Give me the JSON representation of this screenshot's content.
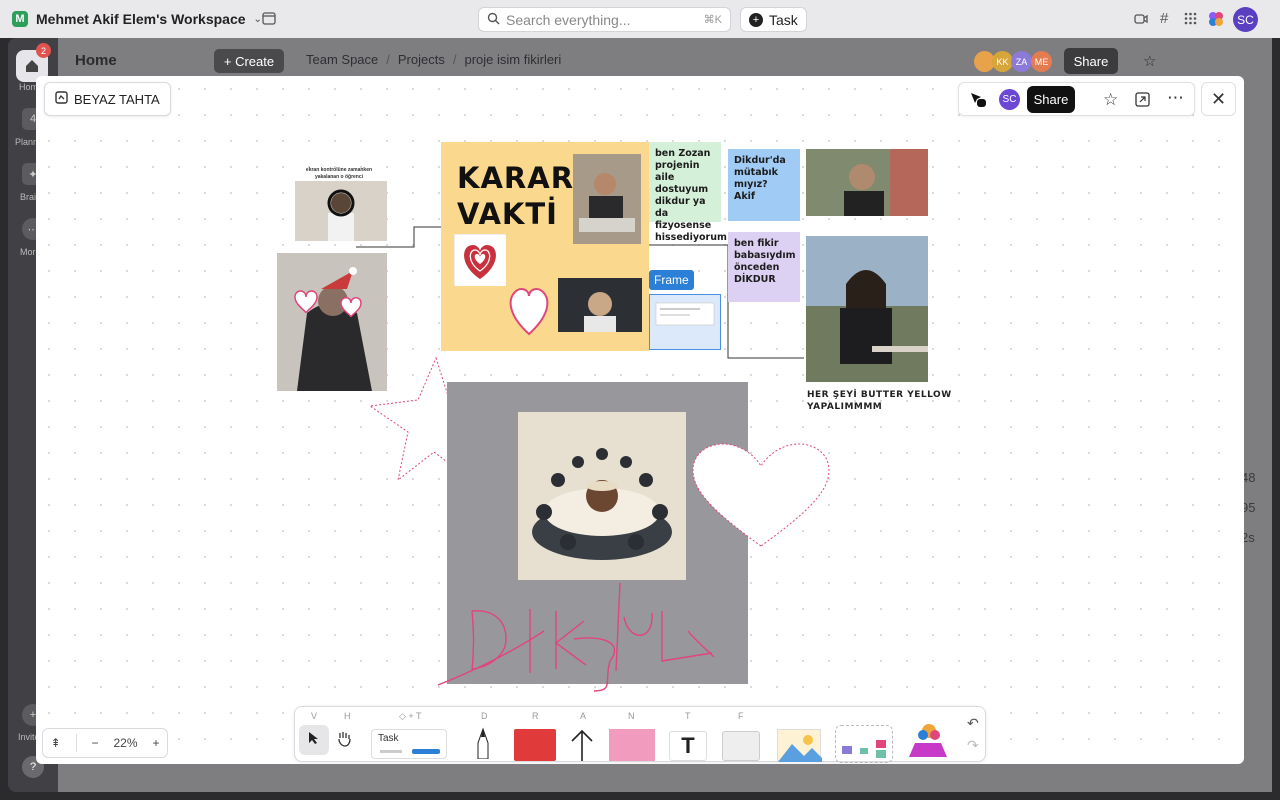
{
  "topbar": {
    "workspace_initial": "M",
    "workspace_name": "Mehmet Akif Elem's Workspace",
    "search_placeholder": "Search everything...",
    "search_shortcut": "⌘K",
    "task_label": "Task",
    "user_initials": "SC"
  },
  "sidebar": {
    "notification_count": "2",
    "items": [
      {
        "label": "Home",
        "badge": ""
      },
      {
        "label": "Planner",
        "badge": "4"
      },
      {
        "label": "Brain",
        "badge": ""
      },
      {
        "label": "More",
        "badge": ""
      },
      {
        "label": "Invite",
        "badge": ""
      }
    ]
  },
  "header": {
    "title": "Home",
    "create_label": "+ Create",
    "breadcrumb": [
      "Team Space",
      "Projects",
      "proje isim fikirleri"
    ],
    "collaborators": [
      {
        "initials": "",
        "color": "#e8a34a"
      },
      {
        "initials": "KK",
        "color": "#d6a63a"
      },
      {
        "initials": "ZA",
        "color": "#8b7ad8"
      },
      {
        "initials": "ME",
        "color": "#e57b50"
      }
    ],
    "share_label": "Share"
  },
  "right_peek": {
    "numbers": [
      "48",
      "95",
      "2s"
    ]
  },
  "whiteboard": {
    "name": "BEYAZ TAHTA",
    "user_initials": "SC",
    "share_label": "Share",
    "karar_title": "KARAR\nVAKTİ",
    "caption_top_small": "ekran kontrolüne zamanken yakalanan o öğrenci",
    "sticky_green": "ben Zozan\nprojenin aile\ndostuyum\ndikdur ya da\nfizyosense\nhissediyorum",
    "sticky_blue": "Dikdur'da\nmütabık\nmıyız?\nAkif",
    "sticky_purple": "ben fikir\nbabasıydım\nönceden\nDİKDUR",
    "frame_label": "Frame",
    "caption_butter": "HER ŞEYİ BUTTER YELLOW\nYAPALIMMMM",
    "handwriting": "DIKDUR"
  },
  "toolbar": {
    "shortcut_keys": [
      "V",
      "H",
      "◇ + T",
      "D",
      "R",
      "A",
      "N",
      "T",
      "F"
    ],
    "task_card_label": "Task",
    "zoom_level": "22%"
  },
  "colors": {
    "sticky_yellow": "#fad88d",
    "sticky_green": "#d5f0d8",
    "sticky_blue": "#9fcbf5",
    "sticky_purple": "#ddd1f3",
    "frame_gray": "#98989c",
    "pen_pink": "#e0457c",
    "accent_blue": "#2b7fd6"
  }
}
